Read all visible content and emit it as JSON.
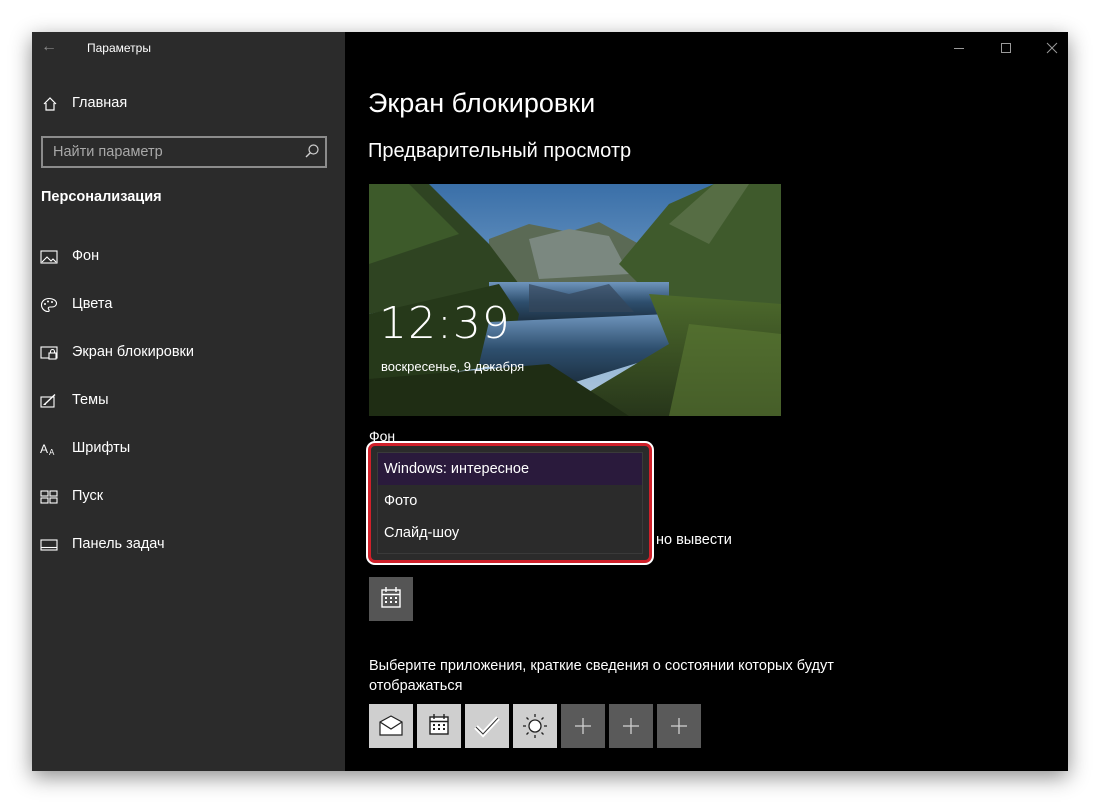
{
  "window": {
    "title": "Параметры"
  },
  "sidebar": {
    "home_label": "Главная",
    "search_placeholder": "Найти параметр",
    "section_heading": "Персонализация",
    "items": [
      {
        "label": "Фон",
        "icon": "image-icon"
      },
      {
        "label": "Цвета",
        "icon": "palette-icon"
      },
      {
        "label": "Экран блокировки",
        "icon": "lock-screen-icon"
      },
      {
        "label": "Темы",
        "icon": "themes-icon"
      },
      {
        "label": "Шрифты",
        "icon": "fonts-icon"
      },
      {
        "label": "Пуск",
        "icon": "start-icon"
      },
      {
        "label": "Панель задач",
        "icon": "taskbar-icon"
      }
    ]
  },
  "main": {
    "page_title": "Экран блокировки",
    "preview_heading": "Предварительный просмотр",
    "preview": {
      "time": "12:39",
      "date": "воскресенье, 9 декабря"
    },
    "background_label": "Фон",
    "background_dropdown": {
      "options": [
        "Windows: интересное",
        "Фото",
        "Слайд-шоу"
      ],
      "selected": "Windows: интересное"
    },
    "detailed_status_partial_text": "но вывести",
    "apps_prompt": "Выберите приложения, краткие сведения о состоянии которых будут отображаться",
    "app_tiles": [
      "mail-icon",
      "calendar-icon",
      "todo-check-icon",
      "weather-sun-icon",
      "add-icon",
      "add-icon",
      "add-icon"
    ]
  },
  "colors": {
    "sidebar_bg": "#2b2b2b",
    "main_bg": "#000000",
    "highlight_border": "#d0202a",
    "selected_item_bg": "#2a1a3c"
  }
}
